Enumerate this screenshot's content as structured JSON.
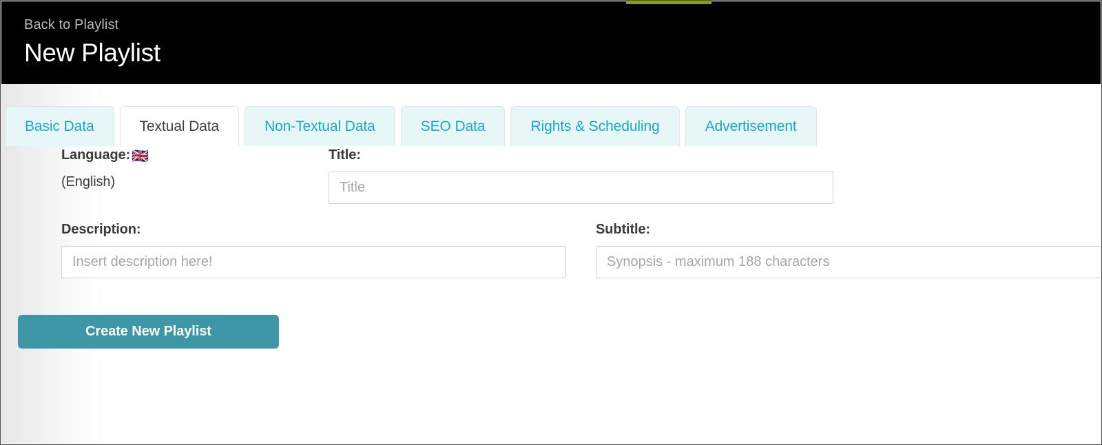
{
  "window": {
    "accent_teal": "#17a8c6",
    "button_teal": "#3d97a6",
    "strip_green": "#8aa011",
    "header_bg": "#000000"
  },
  "header": {
    "back_label": "Back to Playlist",
    "title": "New Playlist"
  },
  "tabs": [
    {
      "label": "Basic Data",
      "active": false
    },
    {
      "label": "Textual Data",
      "active": true
    },
    {
      "label": "Non-Textual Data",
      "active": false
    },
    {
      "label": "SEO Data",
      "active": false
    },
    {
      "label": "Rights & Scheduling",
      "active": false
    },
    {
      "label": "Advertisement",
      "active": false
    }
  ],
  "form": {
    "language": {
      "label": "Language:",
      "flag_icon": "🇬🇧",
      "value": "(English)"
    },
    "title": {
      "label": "Title:",
      "placeholder": "Title",
      "value": ""
    },
    "description": {
      "label": "Description:",
      "placeholder": "Insert description here!",
      "value": ""
    },
    "subtitle": {
      "label": "Subtitle:",
      "placeholder": "Synopsis - maximum 188 characters",
      "value": ""
    },
    "submit_label": "Create New Playlist"
  }
}
